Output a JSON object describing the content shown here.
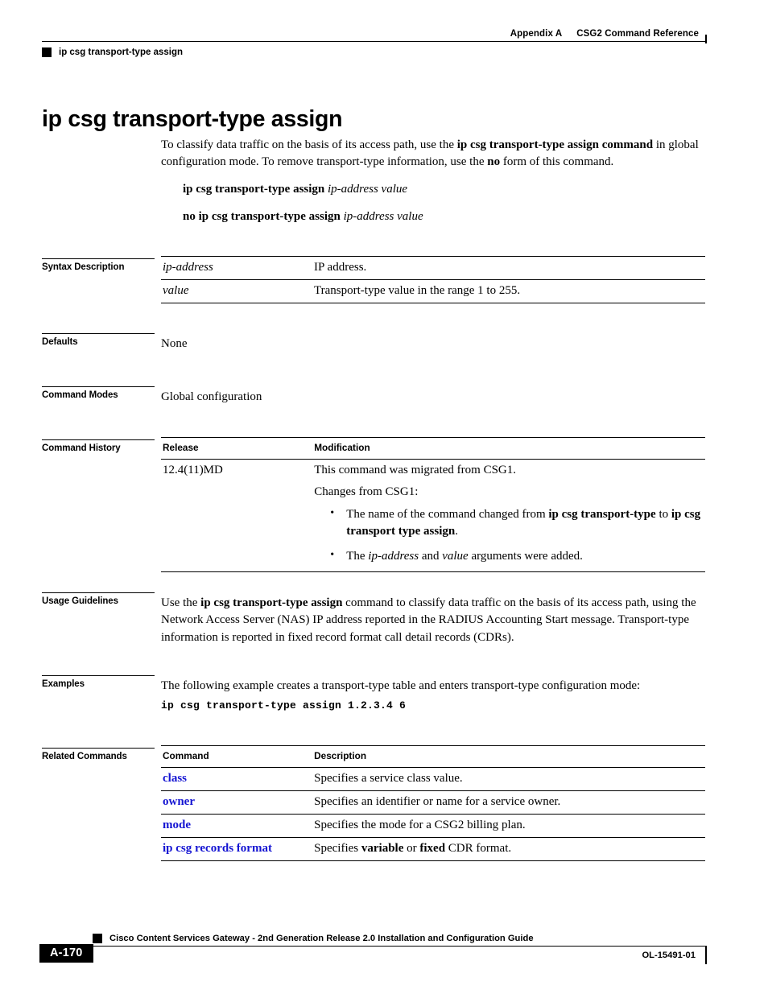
{
  "header": {
    "appendix": "Appendix A",
    "chapter": "CSG2 Command Reference",
    "running_head": "ip csg transport-type assign"
  },
  "title": "ip csg transport-type assign",
  "intro": {
    "p1_a": "To classify data traffic on the basis of its access path, use the ",
    "p1_b": "ip csg transport-type assign command",
    "p1_c": " in global configuration mode. To remove transport-type information, use the ",
    "p1_d": "no",
    "p1_e": " form of this command.",
    "syntax_pos_bold": "ip csg transport-type assign",
    "syntax_pos_args": "ip-address value",
    "syntax_neg_bold": "no ip csg transport-type assign",
    "syntax_neg_args": "ip-address value"
  },
  "sections": {
    "syntax_description": {
      "label": "Syntax Description",
      "rows": [
        {
          "term": "ip-address",
          "desc": "IP address."
        },
        {
          "term": "value",
          "desc": "Transport-type value in the range 1 to 255."
        }
      ]
    },
    "defaults": {
      "label": "Defaults",
      "text": "None"
    },
    "command_modes": {
      "label": "Command Modes",
      "text": "Global configuration"
    },
    "command_history": {
      "label": "Command History",
      "col_release": "Release",
      "col_modification": "Modification",
      "release": "12.4(11)MD",
      "mod_line1": "This command was migrated from CSG1.",
      "mod_line2": "Changes from CSG1:",
      "bullet1_a": "The name of the command changed from ",
      "bullet1_b": "ip csg transport-type",
      "bullet1_c": " to ",
      "bullet1_d": "ip csg transport type assign",
      "bullet1_e": ".",
      "bullet2_a": "The ",
      "bullet2_b": "ip-address",
      "bullet2_c": " and ",
      "bullet2_d": "value",
      "bullet2_e": " arguments were added.",
      "bullet_glyph": "•"
    },
    "usage_guidelines": {
      "label": "Usage Guidelines",
      "p_a": "Use the ",
      "p_b": "ip csg transport-type assign",
      "p_c": " command to classify data traffic on the basis of its access path, using the Network Access Server (NAS) IP address reported in the RADIUS Accounting Start message. Transport-type information is reported in fixed record format call detail records (CDRs)."
    },
    "examples": {
      "label": "Examples",
      "intro": "The following example creates a transport-type table and enters transport-type configuration mode:",
      "code": "ip csg transport-type assign 1.2.3.4 6"
    },
    "related_commands": {
      "label": "Related Commands",
      "col_command": "Command",
      "col_description": "Description",
      "rows": [
        {
          "command": "class",
          "desc_a": "Specifies a service class value.",
          "desc_b": "",
          "desc_c": "",
          "desc_d": "",
          "desc_e": ""
        },
        {
          "command": "owner",
          "desc_a": "Specifies an identifier or name for a service owner.",
          "desc_b": "",
          "desc_c": "",
          "desc_d": "",
          "desc_e": ""
        },
        {
          "command": "mode",
          "desc_a": "Specifies the mode for a CSG2 billing plan.",
          "desc_b": "",
          "desc_c": "",
          "desc_d": "",
          "desc_e": ""
        },
        {
          "command": "ip csg records format",
          "desc_a": "Specifies ",
          "desc_b": "variable",
          "desc_c": " or ",
          "desc_d": "fixed",
          "desc_e": " CDR format."
        }
      ]
    }
  },
  "footer": {
    "doc_title": "Cisco Content Services Gateway - 2nd Generation Release 2.0 Installation and Configuration Guide",
    "page_number": "A-170",
    "doc_id": "OL-15491-01"
  },
  "colors": {
    "link": "#1414d2",
    "text": "#000000",
    "background": "#ffffff"
  }
}
